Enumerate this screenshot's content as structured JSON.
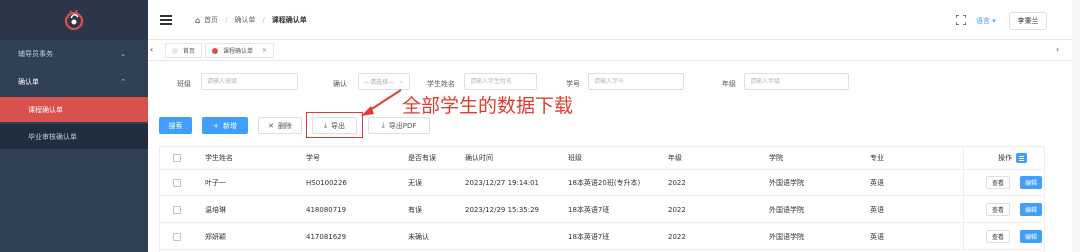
{
  "sidebar": {
    "items": [
      {
        "label": "辅导员事务",
        "arrow": "⌄"
      },
      {
        "label": "确认单",
        "arrow": "⌃"
      },
      {
        "label": "课程确认单"
      },
      {
        "label": "毕业审核确认单"
      }
    ]
  },
  "header": {
    "breadcrumb": {
      "home": "首页",
      "level2": "确认单",
      "current": "课程确认单"
    },
    "language": "语言",
    "user": "李秉兰"
  },
  "tabs": [
    {
      "label": "首页"
    },
    {
      "label": "课程确认单",
      "active": true
    }
  ],
  "form": {
    "class_label": "班级",
    "class_placeholder": "请输入班级",
    "confirm_label": "确认",
    "confirm_placeholder": "—请选择—",
    "name_label": "学生姓名",
    "name_placeholder": "请输入学生姓名",
    "id_label": "学号",
    "id_placeholder": "请输入学号",
    "grade_label": "年级",
    "grade_placeholder": "请输入年级"
  },
  "toolbar": {
    "search": "搜索",
    "add": "新增",
    "delete": "删除",
    "export": "导出",
    "export_pdf": "导出PDF"
  },
  "annotation": "全部学生的数据下载",
  "table": {
    "columns": [
      "学生姓名",
      "学号",
      "是否有误",
      "确认时间",
      "班级",
      "年级",
      "学院",
      "专业",
      "操作"
    ],
    "rows": [
      {
        "name": "叶子一",
        "id": "HS0100226",
        "error": "无误",
        "time": "2023/12/27 19:14:01",
        "class": "18本英语20班(专升本)",
        "grade": "2022",
        "college": "外国语学院",
        "major": "英语"
      },
      {
        "name": "温培琳",
        "id": "418080719",
        "error": "有误",
        "time": "2023/12/29 15:35:29",
        "class": "18本英语7班",
        "grade": "2022",
        "college": "外国语学院",
        "major": "英语"
      },
      {
        "name": "郑妍颖",
        "id": "417081629",
        "error": "未确认",
        "time": "",
        "class": "18本英语7班",
        "grade": "2022",
        "college": "外国语学院",
        "major": "英语"
      }
    ],
    "view_label": "查看",
    "edit_label": "编辑"
  },
  "colors": {
    "primary": "#409eff",
    "accent": "#d9514c",
    "sidebar": "#304156",
    "annotation": "#e03c31"
  }
}
